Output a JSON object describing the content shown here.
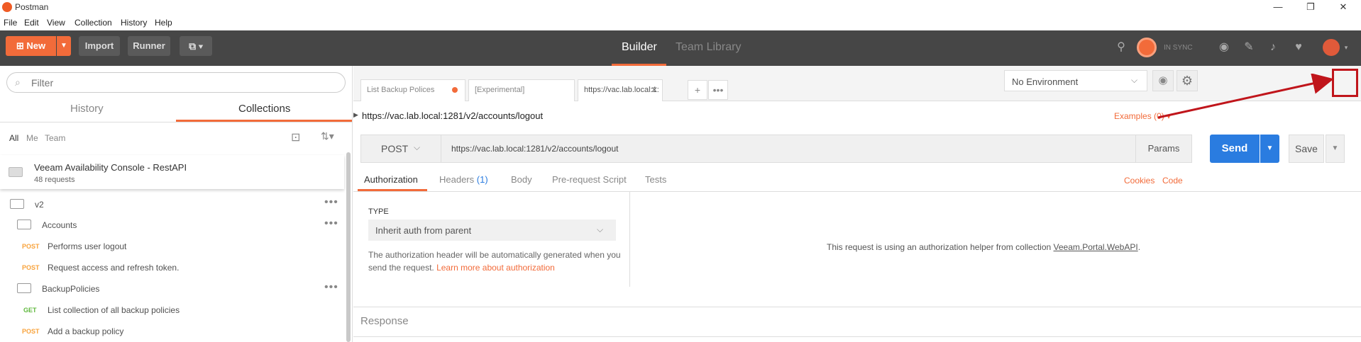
{
  "window": {
    "title": "Postman",
    "controls": [
      "—",
      "❐",
      "✕"
    ]
  },
  "menu": [
    "File",
    "Edit",
    "View",
    "Collection",
    "History",
    "Help"
  ],
  "header": {
    "new_label": "New",
    "import_label": "Import",
    "runner_label": "Runner",
    "builder_label": "Builder",
    "team_library_label": "Team Library",
    "sync_label": "IN SYNC"
  },
  "sidebar": {
    "filter_placeholder": "Filter",
    "tabs": [
      "History",
      "Collections"
    ],
    "active_tab": "Collections",
    "subtabs": [
      "All",
      "Me",
      "Team"
    ],
    "collection": {
      "name": "Veeam Availability Console - RestAPI",
      "count": "48 requests"
    },
    "tree": [
      {
        "kind": "folder",
        "label": "v2"
      },
      {
        "kind": "folder",
        "label": "Accounts"
      },
      {
        "kind": "request",
        "method": "POST",
        "label": "Performs user logout"
      },
      {
        "kind": "request",
        "method": "POST",
        "label": "Request access and refresh token."
      },
      {
        "kind": "folder",
        "label": "BackupPolicies"
      },
      {
        "kind": "request",
        "method": "GET",
        "label": "List collection of all backup policies"
      },
      {
        "kind": "request",
        "method": "POST",
        "label": "Add a backup policy"
      }
    ]
  },
  "main": {
    "tabs": [
      "List Backup Polices",
      "[Experimental]",
      "https://vac.lab.local:1:"
    ],
    "environment": "No Environment",
    "request_title": "https://vac.lab.local:1281/v2/accounts/logout",
    "examples": "Examples (0)",
    "method": "POST",
    "url": "https://vac.lab.local:1281/v2/accounts/logout",
    "params_label": "Params",
    "send_label": "Send",
    "save_label": "Save",
    "request_tabs": {
      "authorization": "Authorization",
      "headers": "Headers",
      "headers_count": "(1)",
      "body": "Body",
      "prerequest": "Pre-request Script",
      "tests": "Tests"
    },
    "cookies_label": "Cookies",
    "code_label": "Code",
    "auth": {
      "type_label": "TYPE",
      "type_value": "Inherit auth from parent",
      "desc": "The authorization header will be automatically generated when you send the request.",
      "learn_more": "Learn more about authorization",
      "info_prefix": "This request is using an authorization helper from collection",
      "info_collection": "Veeam.Portal.WebAPI",
      "info_suffix": "."
    },
    "response_label": "Response"
  },
  "colors": {
    "accent": "#f26b3a",
    "send": "#2a7ce0",
    "header_bg": "#464646",
    "annotation": "#c0151b"
  }
}
